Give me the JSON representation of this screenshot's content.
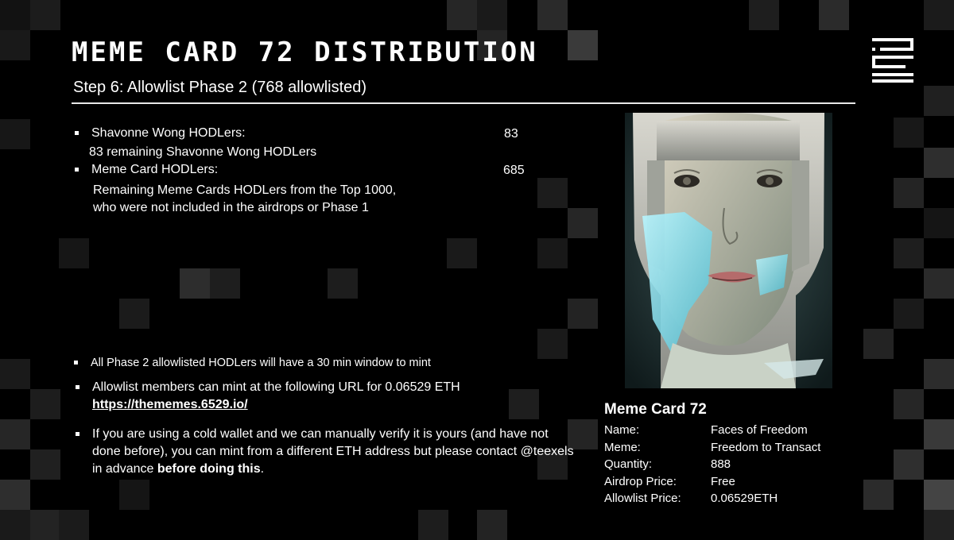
{
  "header": {
    "title": "MEME CARD 72 DISTRIBUTION",
    "subtitle": "Step 6:  Allowlist Phase 2 (768 allowlisted)"
  },
  "groups": [
    {
      "label": "Shavonne Wong HODLers:",
      "count": "83",
      "description": "83 remaining Shavonne Wong HODLers"
    },
    {
      "label": "Meme Card HODLers:",
      "count": "685",
      "description_lines": [
        "Remaining Meme Cards HODLers from the Top 1000,",
        "who were not included in the airdrops or Phase 1"
      ]
    }
  ],
  "notes": {
    "window": "All Phase 2 allowlisted HODLers will have a 30 min window to mint",
    "mint_text": "Allowlist members can mint at the following URL for 0.06529 ETH",
    "mint_url": "https://thememes.6529.io/",
    "cold_wallet_text": "If you are using a cold wallet and we can manually verify it is yours (and have not done before), you can mint from a different ETH address but please contact @teexels in advance ",
    "cold_wallet_bold": "before doing this",
    "cold_wallet_end": "."
  },
  "card": {
    "title": "Meme Card 72",
    "rows": [
      {
        "key": "Name:",
        "value": "Faces of Freedom"
      },
      {
        "key": "Meme:",
        "value": "Freedom to Transact"
      },
      {
        "key": "Quantity:",
        "value": "888"
      },
      {
        "key": "Airdrop Price:",
        "value": "Free"
      },
      {
        "key": "Allowlist Price:",
        "value": "0.06529ETH"
      }
    ]
  },
  "icons": {
    "logo": "6529-logo-icon",
    "portrait": "portrait-artwork-image"
  },
  "colors": {
    "background": "#000000",
    "text": "#ffffff",
    "rule": "#e8e8e8"
  }
}
